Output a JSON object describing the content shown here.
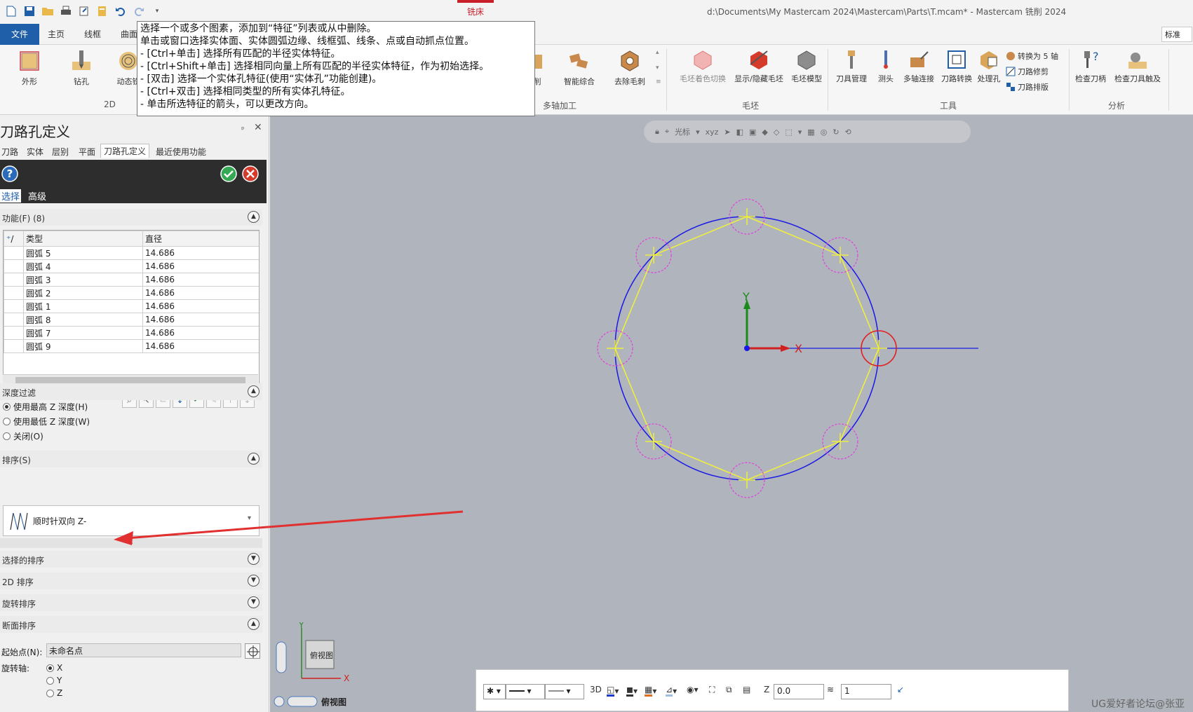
{
  "window": {
    "title": "d:\\Documents\\My Mastercam 2024\\Mastercam\\Parts\\T.mcam* - Mastercam 铣削 2024",
    "context_tab": "铣床",
    "style_select": "标准"
  },
  "ribbon_tabs": [
    "文件",
    "主页",
    "线框",
    "曲面"
  ],
  "ribbon": {
    "groups": {
      "2d": "2D",
      "multiaxis": "多轴加工",
      "stock": "毛坯",
      "tools": "工具",
      "analysis": "分析"
    },
    "buttons": {
      "contour": "外形",
      "drill": "钻孔",
      "dynamic": "动态铣",
      "cut_partial": "削",
      "smart": "智能综合",
      "deburr": "去除毛刺",
      "stock_shade": "毛坯着色切换",
      "show_hide_stock": "显示/隐藏毛坯",
      "stock_model": "毛坯模型",
      "tool_manager": "刀具管理",
      "probe": "测头",
      "multiaxis_link": "多轴连接",
      "toolpath_transform": "刀路转换",
      "hole_process": "处理孔",
      "convert_5axis": "转换为 5 轴",
      "toolpath_trim": "刀路修剪",
      "toolpath_nest": "刀路排版",
      "check_holder": "检查刀柄",
      "check_tool_reach": "检查刀具触及"
    }
  },
  "tooltip": {
    "lines": [
      "选择一个或多个图素，添加到“特征”列表或从中删除。",
      "单击或窗口选择实体面、实体圆弧边缘、线框弧、线条、点或自动抓点位置。",
      "- [Ctrl+单击] 选择所有匹配的半径实体特征。",
      "- [Ctrl+Shift+单击] 选择相同向量上所有匹配的半径实体特征，作为初始选择。",
      "- [双击] 选择一个实体孔特征(使用“实体孔”功能创建)。",
      "- [Ctrl+双击] 选择相同类型的所有实体孔特征。",
      "- 单击所选特征的箭头，可以更改方向。"
    ]
  },
  "panel": {
    "title": "刀路孔定义",
    "pin": "ᵖ",
    "close": "✕",
    "tabs": [
      "刀路",
      "实体",
      "层别",
      "平面",
      "刀路孔定义",
      "最近使用功能"
    ],
    "subtabs": [
      "选择",
      "高级"
    ],
    "features_header": "功能(F) (8)",
    "table": {
      "columns": [
        "类型",
        "直径"
      ],
      "rows": [
        [
          "圆弧 5",
          "14.686"
        ],
        [
          "圆弧 4",
          "14.686"
        ],
        [
          "圆弧 3",
          "14.686"
        ],
        [
          "圆弧 2",
          "14.686"
        ],
        [
          "圆弧 1",
          "14.686"
        ],
        [
          "圆弧 8",
          "14.686"
        ],
        [
          "圆弧 7",
          "14.686"
        ],
        [
          "圆弧 9",
          "14.686"
        ]
      ]
    },
    "depth_filter": {
      "header": "深度过滤",
      "options": [
        "使用最高 Z 深度(H)",
        "使用最低 Z 深度(W)",
        "关闭(O)"
      ],
      "selected": 0
    },
    "sort": {
      "header": "排序(S)",
      "value": "顺时针双向 Z-"
    },
    "sections": [
      "选择的排序",
      "2D 排序",
      "旋转排序",
      "断面排序"
    ],
    "start_point_label": "起始点(N):",
    "start_point_value": "未命名点",
    "rotation_axis_label": "旋转轴:",
    "rotation_axis_options": [
      "X",
      "Y",
      "Z"
    ],
    "rotation_axis_selected": 0
  },
  "viewport": {
    "axis_x": "X",
    "axis_y": "Y",
    "triad_x": "X",
    "triad_y": "Y",
    "view_name_cube": "俯视图",
    "view_name_label": "俯视图",
    "view_toolbar_cursor": "光标",
    "colors": {
      "background": "#b0b4bc",
      "circle": "#1a1ae6",
      "polygon": "#f2f23a",
      "holes": "#e040e0",
      "selected_hole": "#e02020"
    }
  },
  "bottom_bar": {
    "mode_3d": "3D",
    "z_label": "Z",
    "z_value": "0.0",
    "level_value": "1"
  },
  "watermark": "UG爱好者论坛@张亚"
}
